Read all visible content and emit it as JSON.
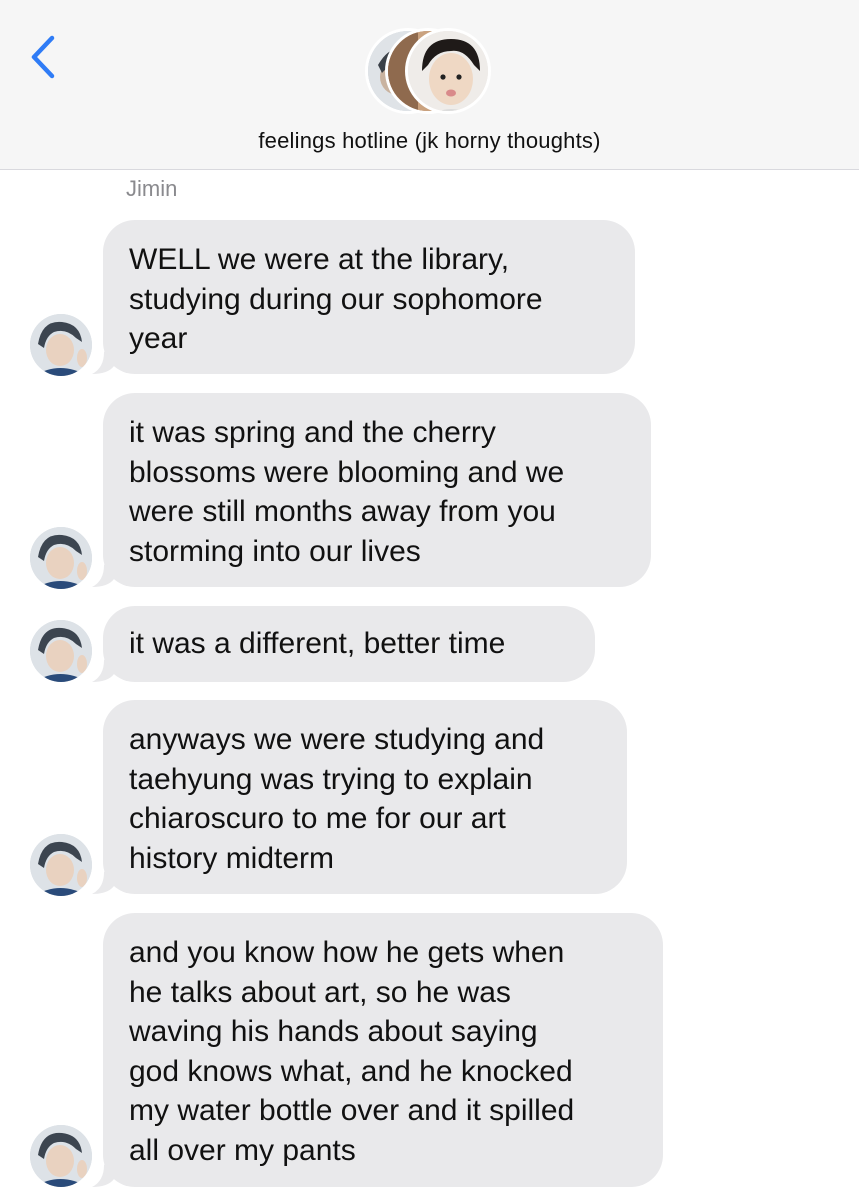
{
  "header": {
    "back_icon": "chevron-left-icon",
    "title": "feelings hotline (jk horny thoughts)",
    "accent_color": "#2f7cf6"
  },
  "thread": {
    "sender_name": "Jimin",
    "bubble_color": "#e9e9eb",
    "messages": [
      {
        "text": "WELL we were at the library,\nstudying during our sophomore\nyear"
      },
      {
        "text": "it was spring and the cherry\nblossoms were blooming and we\nwere still months away from you\nstorming into our lives"
      },
      {
        "text": "it was a different, better time"
      },
      {
        "text": "anyways we were studying and\ntaehyung was trying to explain\nchiaroscuro to me for our art\nhistory midterm"
      },
      {
        "text": "and you know how he gets when\nhe talks about art, so he was\nwaving his hands about saying\ngod knows what, and he knocked\nmy water bottle over and it spilled\nall over my pants"
      }
    ]
  }
}
